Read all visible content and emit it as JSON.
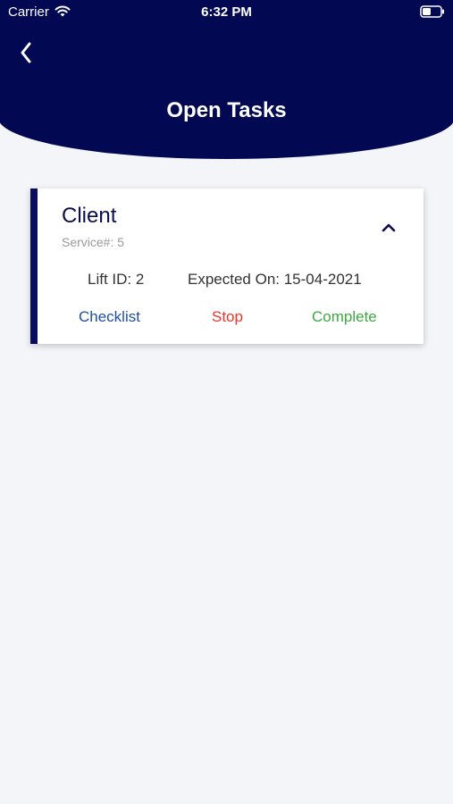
{
  "status_bar": {
    "carrier": "Carrier",
    "time": "6:32 PM",
    "icons": [
      "wifi-icon",
      "battery-icon"
    ]
  },
  "header": {
    "title": "Open Tasks",
    "back_icon": "chevron-left-icon",
    "background_color": "#030852"
  },
  "task": {
    "client": "Client",
    "service": "Service#: 5",
    "lift_id": "Lift ID: 2",
    "expected_on": "Expected On: 15-04-2021",
    "toggle_icon": "chevron-up-icon",
    "actions": {
      "checklist": "Checklist",
      "stop": "Stop",
      "complete": "Complete"
    },
    "colors": {
      "accent": "#0a0c5c",
      "checklist": "#1f4fa4",
      "stop": "#f0322c",
      "complete": "#3ca843"
    }
  }
}
